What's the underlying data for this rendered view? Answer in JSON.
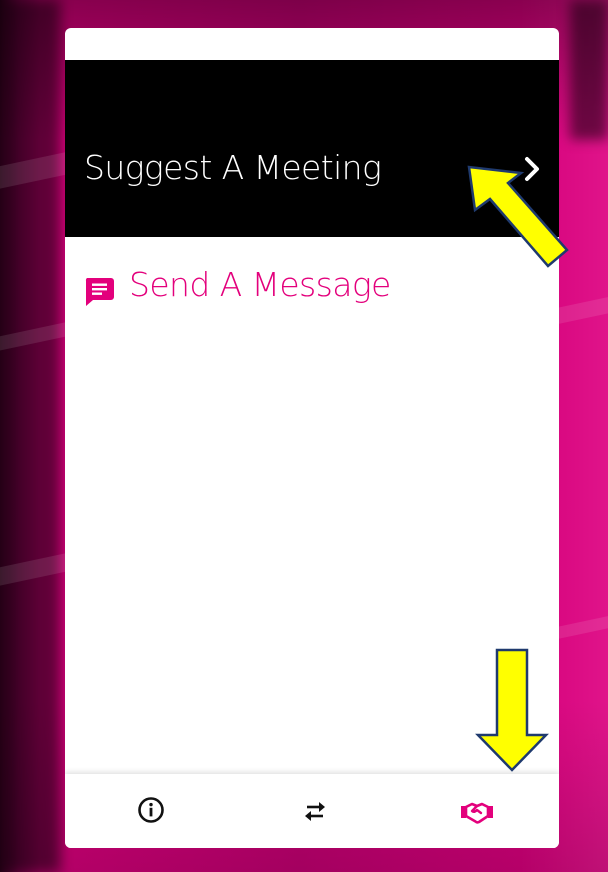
{
  "panel": {
    "meeting": {
      "label": "Suggest A Meeting",
      "chevron_icon": "chevron-right-icon"
    },
    "message": {
      "label": "Send A Message",
      "icon": "chat-message-icon"
    }
  },
  "tabbar": {
    "tabs": [
      {
        "name": "info",
        "icon": "info-circle-icon",
        "active": false
      },
      {
        "name": "exchange",
        "icon": "swap-arrows-icon",
        "active": false
      },
      {
        "name": "meet",
        "icon": "handshake-icon",
        "active": true
      }
    ]
  },
  "annotations": {
    "arrow_color": "#ffff00",
    "arrow_outline": "#1f3a6e",
    "arrows": [
      "arrow-pointing-to-chevron",
      "arrow-pointing-to-handshake-tab"
    ]
  },
  "colors": {
    "accent": "#e3007c",
    "meeting_row_bg": "#000000",
    "panel_bg": "#ffffff",
    "icon_dark": "#111111"
  }
}
